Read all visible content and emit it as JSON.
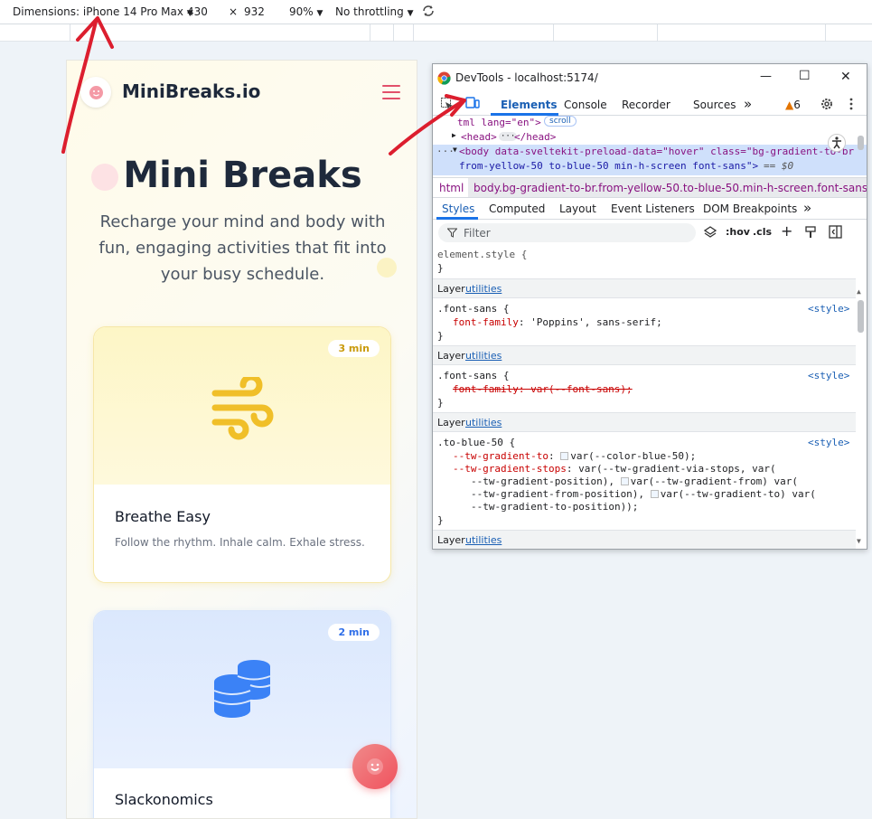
{
  "device_toolbar": {
    "dimensions_label": "Dimensions: iPhone 14 Pro Max",
    "width_value": "430",
    "times": "×",
    "height_value": "932",
    "zoom": "90%",
    "throttling": "No throttling",
    "rotate_icon": "rotate-icon",
    "dropdown_icon": "chevron-down-icon"
  },
  "app": {
    "brand": "MiniBreaks.io",
    "logo_icon": "smiley-icon",
    "menu_icon": "hamburger-icon",
    "hero_title": "Mini Breaks",
    "hero_subtitle": "Recharge your mind and body with fun, engaging activities that fit into your busy schedule.",
    "cards": [
      {
        "badge": "3 min",
        "title": "Breathe Easy",
        "description": "Follow the rhythm. Inhale calm. Exhale stress.",
        "icon": "wind-icon",
        "accent": "#f0bf28"
      },
      {
        "badge": "2 min",
        "title": "Slackonomics",
        "description": "",
        "icon": "coins-icon",
        "accent": "#3b82f6"
      }
    ],
    "fab_icon": "smiley-icon",
    "colors": {
      "brand_pink": "#e2506a",
      "heading": "#1e293b",
      "yellow_badge_text": "#c99a0b",
      "blue_badge_text": "#2f6ee8"
    }
  },
  "devtools": {
    "window_title": "DevTools - localhost:5174/",
    "minimize": "—",
    "maximize": "☐",
    "close": "✕",
    "tabs": [
      "Elements",
      "Console",
      "Recorder",
      "Sources"
    ],
    "more_tabs": "»",
    "warnings_count": "6",
    "dom": {
      "html_line": "tml lang=\"en\">",
      "scroll_badge": "scroll",
      "head_line_open": "<head>",
      "head_ellipsis": "···",
      "head_line_close": "</head>",
      "body_line_1": "<body data-sveltekit-preload-data=\"hover\" class=\"bg-gradient-to-br",
      "body_line_2": "from-yellow-50 to-blue-50 min-h-screen font-sans\">",
      "body_line_2_suffix": "== $0"
    },
    "breadcrumbs": [
      "html",
      "body.bg-gradient-to-br.from-yellow-50.to-blue-50.min-h-screen.font-sans"
    ],
    "subtabs": [
      "Styles",
      "Computed",
      "Layout",
      "Event Listeners",
      "DOM Breakpoints"
    ],
    "subtabs_more": "»",
    "filter_placeholder": "Filter",
    "hov": ":hov",
    "cls": ".cls",
    "plus": "+",
    "styles": {
      "element_style": "element.style {",
      "close_brace": "}",
      "layer_label": "Layer",
      "layer_link": "utilities",
      "rule1_selector": ".font-sans {",
      "rule1_prop": "font-family",
      "rule1_value": ": 'Poppins', sans-serif;",
      "rule1_src": "<style>",
      "rule2_selector": ".font-sans {",
      "rule2_text": "font-family: var(--font-sans);",
      "rule2_src": "<style>",
      "rule3_selector": ".to-blue-50 {",
      "rule3_src": "<style>",
      "rule3_line1_prop": "--tw-gradient-to",
      "rule3_line1_value": "var(--color-blue-50);",
      "rule3_line2_prop": "--tw-gradient-stops",
      "rule3_line2_value": ": var(--tw-gradient-via-stops, var(",
      "rule3_line3": "--tw-gradient-position), ",
      "rule3_line3b": "var(--tw-gradient-from) var(",
      "rule3_line4": "--tw-gradient-from-position), ",
      "rule3_line4b": "var(--tw-gradient-to) var(",
      "rule3_line5": "--tw-gradient-to-position));"
    }
  }
}
